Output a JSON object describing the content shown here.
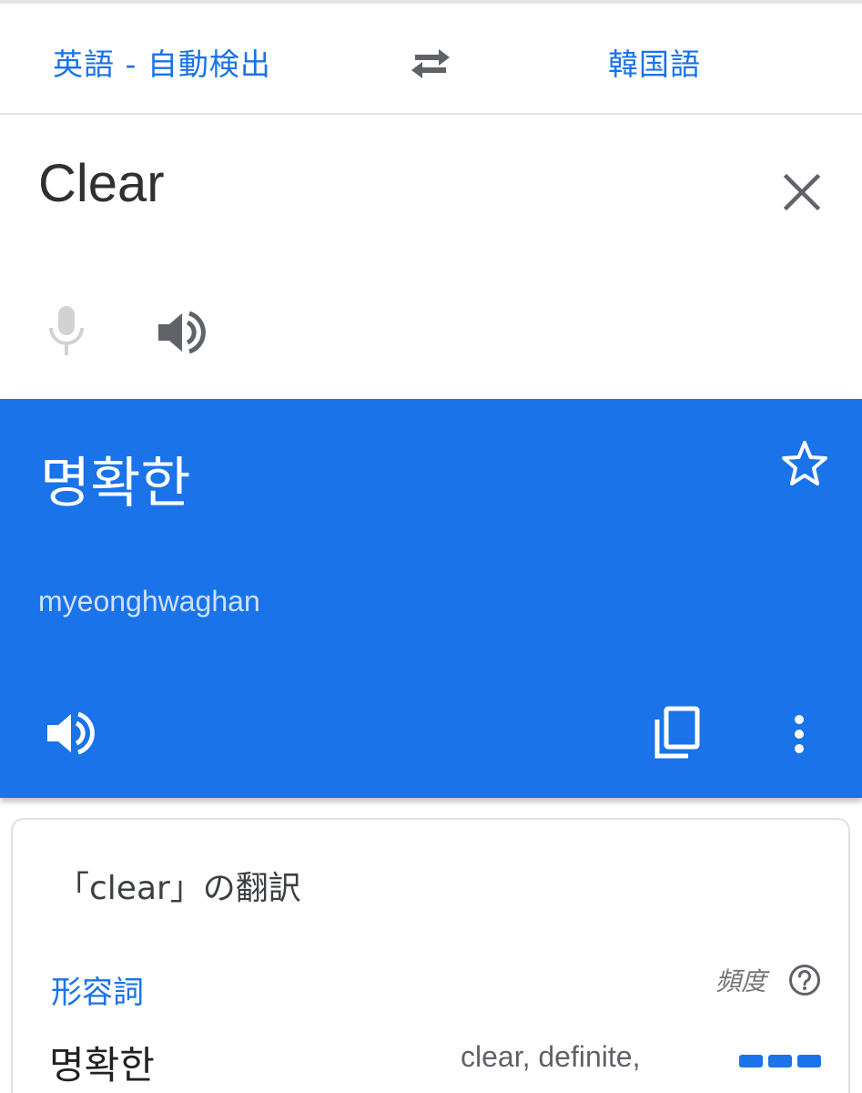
{
  "lang_bar": {
    "source_language": "英語 - 自動検出",
    "target_language": "韓国語",
    "swap_icon": "swap-arrows-icon"
  },
  "input": {
    "text": "Clear",
    "close_icon": "close-icon",
    "mic_icon": "mic-icon",
    "speaker_icon": "speaker-icon"
  },
  "result": {
    "translation": "명확한",
    "romanization": "myeonghwaghan",
    "star_icon": "star-outline-icon",
    "speaker_icon": "speaker-icon",
    "copy_icon": "copy-icon",
    "more_icon": "more-vert-icon",
    "background_color": "#1a73e8"
  },
  "dictionary": {
    "title": "「clear」の翻訳",
    "part_of_speech": "形容詞",
    "frequency_label": "頻度",
    "entries": [
      {
        "word": "명확한",
        "meanings": "clear, definite,",
        "frequency": 3,
        "frequency_max": 3
      }
    ]
  },
  "colors": {
    "accent": "#1a73e8",
    "icon_gray": "#5f6368",
    "disabled_gray": "#c8c8c8"
  }
}
